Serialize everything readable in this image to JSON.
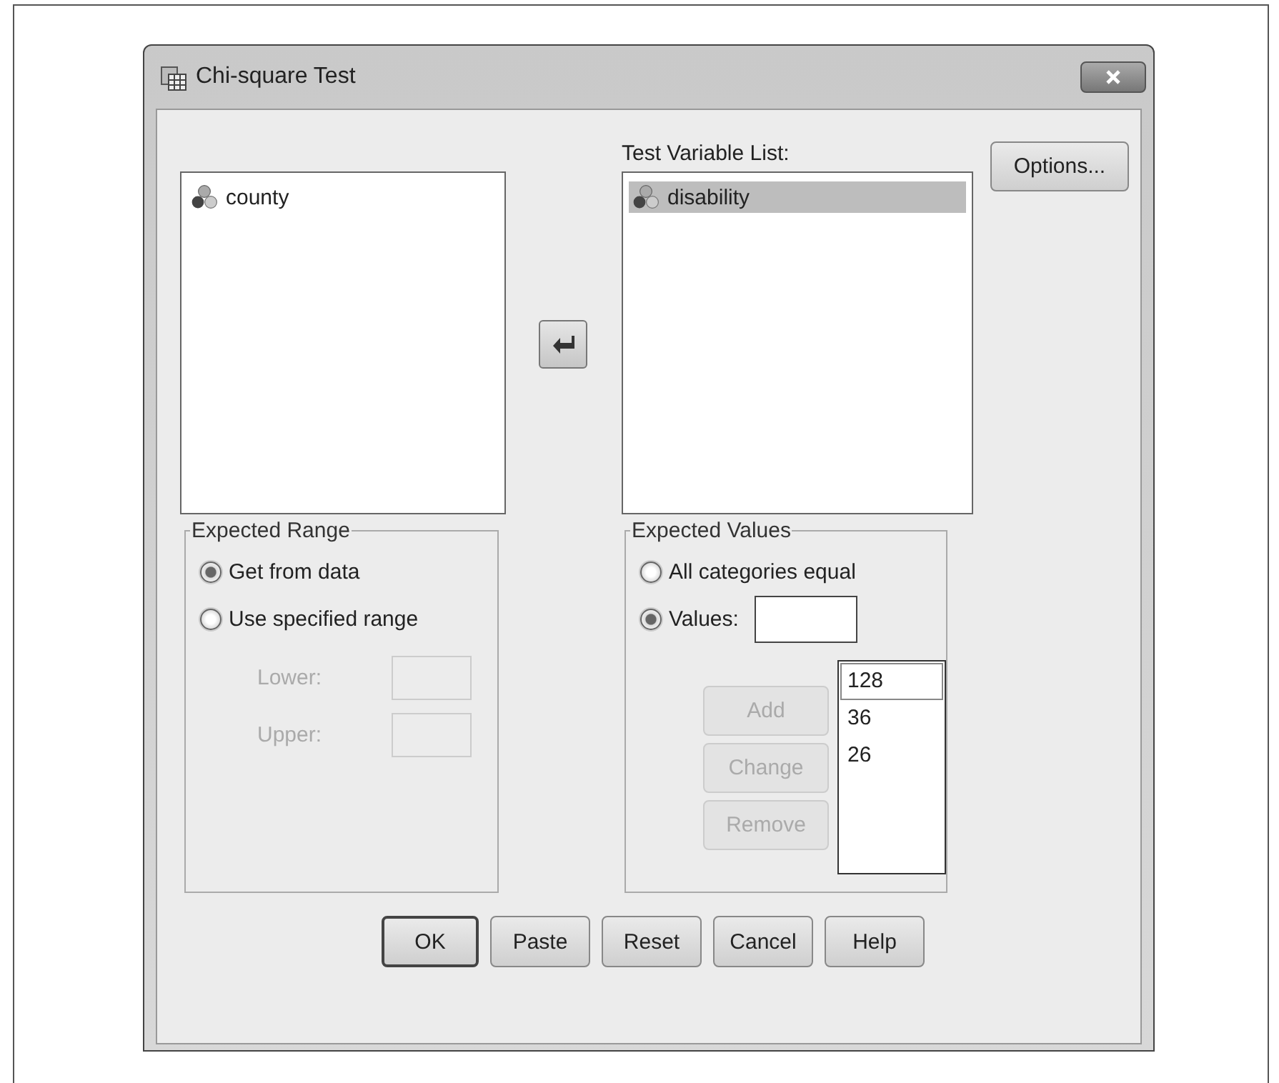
{
  "window": {
    "title": "Chi-square Test"
  },
  "source_list": {
    "items": [
      {
        "label": "county",
        "selected": false
      }
    ]
  },
  "test_variable_list": {
    "label": "Test Variable List:",
    "items": [
      {
        "label": "disability",
        "selected": true
      }
    ]
  },
  "options_button": {
    "label": "Options..."
  },
  "expected_range": {
    "title": "Expected Range",
    "options": [
      {
        "label": "Get from data",
        "selected": true
      },
      {
        "label": "Use specified range",
        "selected": false
      }
    ],
    "fields": [
      {
        "label": "Lower:",
        "disabled": true
      },
      {
        "label": "Upper:",
        "disabled": true
      }
    ]
  },
  "expected_values": {
    "title": "Expected Values",
    "options": [
      {
        "label": "All categories equal",
        "selected": false
      },
      {
        "label": "Values:",
        "selected": true
      }
    ],
    "buttons": [
      {
        "label": "Add",
        "disabled": true
      },
      {
        "label": "Change",
        "disabled": true
      },
      {
        "label": "Remove",
        "disabled": true
      }
    ],
    "values": [
      {
        "text": "128",
        "selected": true
      },
      {
        "text": "36",
        "selected": false
      },
      {
        "text": "26",
        "selected": false
      }
    ]
  },
  "buttons": [
    {
      "label": "OK",
      "default": true
    },
    {
      "label": "Paste",
      "default": false
    },
    {
      "label": "Reset",
      "default": false
    },
    {
      "label": "Cancel",
      "default": false
    },
    {
      "label": "Help",
      "default": false
    }
  ]
}
